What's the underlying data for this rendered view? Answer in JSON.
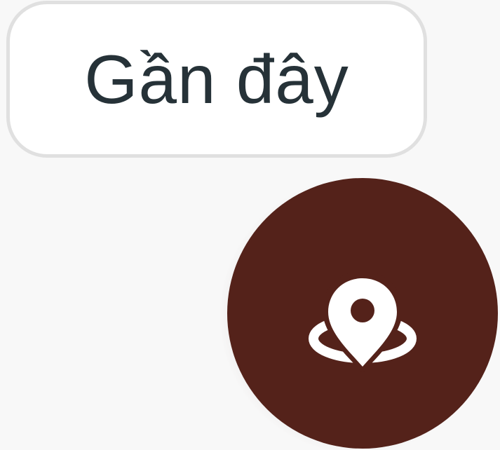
{
  "chip": {
    "label": "Gần đây"
  },
  "fab": {
    "icon": "location-pin-icon"
  },
  "colors": {
    "background": "#f8f8f8",
    "chip_background": "#ffffff",
    "chip_border": "#e0e0e0",
    "chip_text": "#263238",
    "fab_background": "#54221a",
    "icon": "#ffffff"
  }
}
